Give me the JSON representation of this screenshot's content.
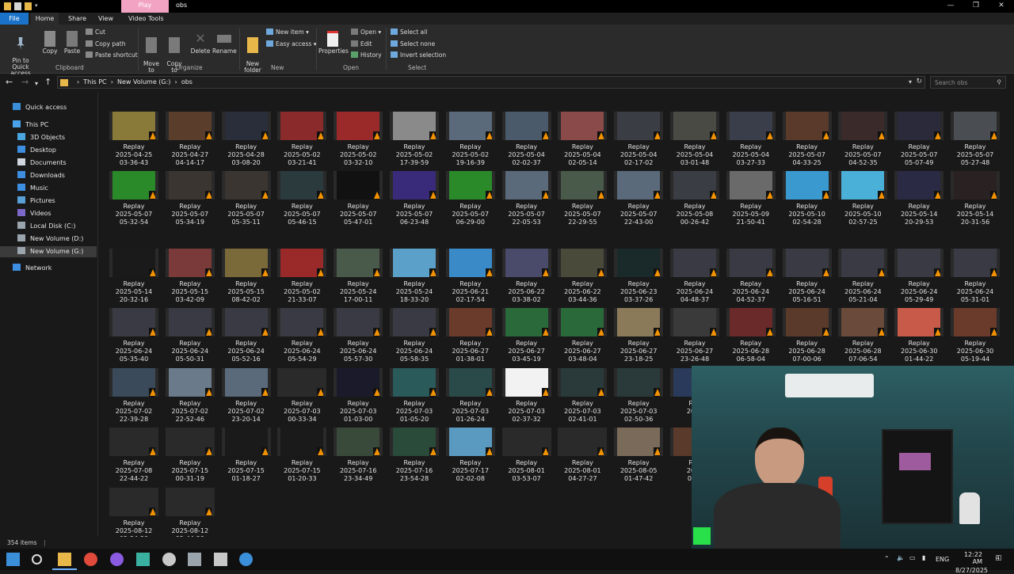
{
  "window": {
    "title": "obs",
    "context_tab": "Play",
    "buttons": {
      "minimize": "—",
      "restore": "❐",
      "close": "✕"
    }
  },
  "ribbon_tabs": [
    "File",
    "Home",
    "Share",
    "View",
    "Video Tools"
  ],
  "ribbon": {
    "clipboard": {
      "pin": "Pin to Quick\naccess",
      "copy": "Copy",
      "paste": "Paste",
      "cut": "Cut",
      "copy_path": "Copy path",
      "paste_shortcut": "Paste shortcut",
      "group": "Clipboard"
    },
    "organize": {
      "move_to": "Move\nto",
      "copy_to": "Copy\nto",
      "delete": "Delete",
      "rename": "Rename",
      "group": "Organize"
    },
    "new": {
      "new_folder": "New\nfolder",
      "new_item": "New item",
      "easy_access": "Easy access",
      "group": "New"
    },
    "open": {
      "properties": "Properties",
      "open": "Open",
      "edit": "Edit",
      "history": "History",
      "group": "Open"
    },
    "select": {
      "select_all": "Select all",
      "select_none": "Select none",
      "invert": "Invert selection",
      "group": "Select"
    }
  },
  "address": {
    "crumbs": [
      "This PC",
      "New Volume (G:)",
      "obs"
    ],
    "search_placeholder": "Search obs"
  },
  "sidebar": [
    {
      "label": "Quick access",
      "icon": "star-icon",
      "color": "#3b8fd9"
    },
    {
      "label": "This PC",
      "icon": "computer-icon",
      "color": "#4aa3e8"
    },
    {
      "label": "3D Objects",
      "icon": "cube-icon",
      "color": "#49a6e0"
    },
    {
      "label": "Desktop",
      "icon": "desktop-icon",
      "color": "#3d8ee0"
    },
    {
      "label": "Documents",
      "icon": "document-icon",
      "color": "#cfd6de"
    },
    {
      "label": "Downloads",
      "icon": "download-icon",
      "color": "#3d8ee0"
    },
    {
      "label": "Music",
      "icon": "music-icon",
      "color": "#3d8ee0"
    },
    {
      "label": "Pictures",
      "icon": "picture-icon",
      "color": "#5aa0d8"
    },
    {
      "label": "Videos",
      "icon": "video-icon",
      "color": "#7b68c8"
    },
    {
      "label": "Local Disk (C:)",
      "icon": "drive-icon",
      "color": "#9aa4ad"
    },
    {
      "label": "New Volume (D:)",
      "icon": "drive-icon",
      "color": "#9aa4ad"
    },
    {
      "label": "New Volume (G:)",
      "icon": "drive-icon",
      "color": "#9aa4ad"
    },
    {
      "label": "Network",
      "icon": "network-icon",
      "color": "#3d8ee0"
    }
  ],
  "files": [
    {
      "name": "Replay",
      "date": "2025-04-25",
      "time": "03-36-43",
      "color": "#8a7a3a"
    },
    {
      "name": "Replay",
      "date": "2025-04-27",
      "time": "04-14-17",
      "color": "#5a3d2a"
    },
    {
      "name": "Replay",
      "date": "2025-04-28",
      "time": "03-08-20",
      "color": "#2a2d3a"
    },
    {
      "name": "Replay",
      "date": "2025-05-02",
      "time": "03-21-41",
      "color": "#8a2a2a"
    },
    {
      "name": "Replay",
      "date": "2025-05-02",
      "time": "03-32-10",
      "color": "#9a2a2a"
    },
    {
      "name": "Replay",
      "date": "2025-05-02",
      "time": "17-39-59",
      "color": "#8a8a8a"
    },
    {
      "name": "Replay",
      "date": "2025-05-02",
      "time": "19-16-39",
      "color": "#5a6a7a"
    },
    {
      "name": "Replay",
      "date": "2025-05-04",
      "time": "02-02-37",
      "color": "#4a5a6a"
    },
    {
      "name": "Replay",
      "date": "2025-05-04",
      "time": "02-05-14",
      "color": "#8a4a4a"
    },
    {
      "name": "Replay",
      "date": "2025-05-04",
      "time": "02-17-02",
      "color": "#3a3d44"
    },
    {
      "name": "Replay",
      "date": "2025-05-04",
      "time": "03-01-48",
      "color": "#4a4a44"
    },
    {
      "name": "Replay",
      "date": "2025-05-04",
      "time": "03-27-33",
      "color": "#3a3d4a"
    },
    {
      "name": "Replay",
      "date": "2025-05-07",
      "time": "04-33-25",
      "color": "#5a3a2a"
    },
    {
      "name": "Replay",
      "date": "2025-05-07",
      "time": "04-52-35",
      "color": "#3a2a2a"
    },
    {
      "name": "Replay",
      "date": "2025-05-07",
      "time": "05-07-49",
      "color": "#2a2a3a"
    },
    {
      "name": "Replay",
      "date": "2025-05-07",
      "time": "05-27-48",
      "color": "#4a4d52"
    },
    {
      "name": "Replay",
      "date": "2025-05-07",
      "time": "05-32-54",
      "color": "#2a8a2a"
    },
    {
      "name": "Replay",
      "date": "2025-05-07",
      "time": "05-34-19",
      "color": "#3a3530"
    },
    {
      "name": "Replay",
      "date": "2025-05-07",
      "time": "05-35-11",
      "color": "#3a3530"
    },
    {
      "name": "Replay",
      "date": "2025-05-07",
      "time": "05-46-15",
      "color": "#2a3a3d"
    },
    {
      "name": "Replay",
      "date": "2025-05-07",
      "time": "05-47-01",
      "color": "#111111"
    },
    {
      "name": "Replay",
      "date": "2025-05-07",
      "time": "06-23-48",
      "color": "#3a2a7a"
    },
    {
      "name": "Replay",
      "date": "2025-05-07",
      "time": "06-29-00",
      "color": "#2a8a2a"
    },
    {
      "name": "Replay",
      "date": "2025-05-07",
      "time": "22-05-53",
      "color": "#5a6a7a"
    },
    {
      "name": "Replay",
      "date": "2025-05-07",
      "time": "22-29-55",
      "color": "#4a5a4a"
    },
    {
      "name": "Replay",
      "date": "2025-05-07",
      "time": "22-43-00",
      "color": "#5a6a7a"
    },
    {
      "name": "Replay",
      "date": "2025-05-08",
      "time": "00-26-42",
      "color": "#3a3d44"
    },
    {
      "name": "Replay",
      "date": "2025-05-09",
      "time": "21-50-41",
      "color": "#6a6a6a"
    },
    {
      "name": "Replay",
      "date": "2025-05-10",
      "time": "02-54-28",
      "color": "#3a9ad0"
    },
    {
      "name": "Replay",
      "date": "2025-05-10",
      "time": "02-57-25",
      "color": "#4ab0d8"
    },
    {
      "name": "Replay",
      "date": "2025-05-14",
      "time": "20-29-53",
      "color": "#2a2a44"
    },
    {
      "name": "Replay",
      "date": "2025-05-14",
      "time": "20-31-56",
      "color": "#2a2222"
    },
    {
      "name": "Replay",
      "date": "2025-05-14",
      "time": "20-32-16",
      "color": "#1a1a1a"
    },
    {
      "name": "Replay",
      "date": "2025-05-15",
      "time": "03-42-09",
      "color": "#7a3a3a"
    },
    {
      "name": "Replay",
      "date": "2025-05-15",
      "time": "08-42-02",
      "color": "#7a6a3a"
    },
    {
      "name": "Replay",
      "date": "2025-05-02",
      "time": "21-33-07",
      "color": "#9a2a2a"
    },
    {
      "name": "Replay",
      "date": "2025-05-24",
      "time": "17-00-11",
      "color": "#4a5a4a"
    },
    {
      "name": "Replay",
      "date": "2025-05-24",
      "time": "18-33-20",
      "color": "#5aa0c8"
    },
    {
      "name": "Replay",
      "date": "2025-06-21",
      "time": "02-17-54",
      "color": "#3a8ac8"
    },
    {
      "name": "Replay",
      "date": "2025-06-22",
      "time": "03-38-02",
      "color": "#4a4a6a"
    },
    {
      "name": "Replay",
      "date": "2025-06-22",
      "time": "03-44-36",
      "color": "#4a4a3a"
    },
    {
      "name": "Replay",
      "date": "2025-06-23",
      "time": "03-37-26",
      "color": "#1a2a2a"
    },
    {
      "name": "Replay",
      "date": "2025-06-24",
      "time": "04-48-37",
      "color": "#3a3a44"
    },
    {
      "name": "Replay",
      "date": "2025-06-24",
      "time": "04-52-37",
      "color": "#3a3a44"
    },
    {
      "name": "Replay",
      "date": "2025-06-24",
      "time": "05-16-51",
      "color": "#3a3a44"
    },
    {
      "name": "Replay",
      "date": "2025-06-24",
      "time": "05-21-04",
      "color": "#3a3a44"
    },
    {
      "name": "Replay",
      "date": "2025-06-24",
      "time": "05-29-49",
      "color": "#3a3a44"
    },
    {
      "name": "Replay",
      "date": "2025-06-24",
      "time": "05-31-01",
      "color": "#3a3a44"
    },
    {
      "name": "Replay",
      "date": "2025-06-24",
      "time": "05-35-40",
      "color": "#3a3a44"
    },
    {
      "name": "Replay",
      "date": "2025-06-24",
      "time": "05-50-31",
      "color": "#3a3a44"
    },
    {
      "name": "Replay",
      "date": "2025-06-24",
      "time": "05-52-16",
      "color": "#3a3a44"
    },
    {
      "name": "Replay",
      "date": "2025-06-24",
      "time": "05-54-29",
      "color": "#3a3a44"
    },
    {
      "name": "Replay",
      "date": "2025-06-24",
      "time": "05-57-30",
      "color": "#3a3a44"
    },
    {
      "name": "Replay",
      "date": "2025-06-24",
      "time": "05-58-35",
      "color": "#3a3a44"
    },
    {
      "name": "Replay",
      "date": "2025-06-27",
      "time": "01-38-01",
      "color": "#6a3a2a"
    },
    {
      "name": "Replay",
      "date": "2025-06-27",
      "time": "03-45-19",
      "color": "#2a6a3a"
    },
    {
      "name": "Replay",
      "date": "2025-06-27",
      "time": "03-48-04",
      "color": "#2a6a3a"
    },
    {
      "name": "Replay",
      "date": "2025-06-27",
      "time": "23-18-25",
      "color": "#8a7a5a"
    },
    {
      "name": "Replay",
      "date": "2025-06-27",
      "time": "23-26-48",
      "color": "#3a3a3a"
    },
    {
      "name": "Replay",
      "date": "2025-06-28",
      "time": "06-58-04",
      "color": "#6a2a2a"
    },
    {
      "name": "Replay",
      "date": "2025-06-28",
      "time": "07-00-06",
      "color": "#5a3a2a"
    },
    {
      "name": "Replay",
      "date": "2025-06-28",
      "time": "07-06-54",
      "color": "#6a4a3a"
    },
    {
      "name": "Replay",
      "date": "2025-06-30",
      "time": "01-44-22",
      "color": "#c85a4a"
    },
    {
      "name": "Replay",
      "date": "2025-06-30",
      "time": "05-19-44",
      "color": "#6a3a2a"
    },
    {
      "name": "Replay",
      "date": "2025-07-02",
      "time": "22-39-28",
      "color": "#3a4a5a"
    },
    {
      "name": "Replay",
      "date": "2025-07-02",
      "time": "22-52-46",
      "color": "#6a7a8a"
    },
    {
      "name": "Replay",
      "date": "2025-07-02",
      "time": "23-20-14",
      "color": "#5a6a7a"
    },
    {
      "name": "Replay",
      "date": "2025-07-03",
      "time": "00-33-34",
      "color": "#2a2a2a"
    },
    {
      "name": "Replay",
      "date": "2025-07-03",
      "time": "01-03-00",
      "color": "#1a1a2a"
    },
    {
      "name": "Replay",
      "date": "2025-07-03",
      "time": "01-05-20",
      "color": "#2a5a5a"
    },
    {
      "name": "Replay",
      "date": "2025-07-03",
      "time": "01-26-24",
      "color": "#2a4a4a"
    },
    {
      "name": "Replay",
      "date": "2025-07-03",
      "time": "02-37-32",
      "color": "#f2f2f2"
    },
    {
      "name": "Replay",
      "date": "2025-07-03",
      "time": "02-41-01",
      "color": "#2a3a3a"
    },
    {
      "name": "Replay",
      "date": "2025-07-03",
      "time": "02-50-36",
      "color": "#2a3a3a"
    },
    {
      "name": "Rep",
      "date": "2025",
      "time": "",
      "color": "#2a3a5a"
    },
    {
      "name": "Replay",
      "date": "2025-07-08",
      "time": "22-44-22",
      "color": "#2a2a2a"
    },
    {
      "name": "Replay",
      "date": "2025-07-15",
      "time": "00-31-19",
      "color": "#2a2a2a"
    },
    {
      "name": "Replay",
      "date": "2025-07-15",
      "time": "01-18-27",
      "color": "#1a1a1a"
    },
    {
      "name": "Replay",
      "date": "2025-07-15",
      "time": "01-20-33",
      "color": "#1a1a1a"
    },
    {
      "name": "Replay",
      "date": "2025-07-16",
      "time": "23-34-49",
      "color": "#3a4a3a"
    },
    {
      "name": "Replay",
      "date": "2025-07-16",
      "time": "23-54-28",
      "color": "#2a4a3a"
    },
    {
      "name": "Replay",
      "date": "2025-07-17",
      "time": "02-02-08",
      "color": "#5a9ac0"
    },
    {
      "name": "Replay",
      "date": "2025-08-01",
      "time": "03-53-07",
      "color": "#2a2a2a"
    },
    {
      "name": "Replay",
      "date": "2025-08-01",
      "time": "04-27-27",
      "color": "#2a2a2a"
    },
    {
      "name": "Replay",
      "date": "2025-08-05",
      "time": "01-47-42",
      "color": "#7a6a5a"
    },
    {
      "name": "Rep",
      "date": "2025",
      "time": "01-5",
      "color": "#5a3a2a"
    },
    {
      "name": "Replay",
      "date": "2025-08-12",
      "time": "05-34-59",
      "color": "#2a2a2a"
    },
    {
      "name": "Replay",
      "date": "2025-08-12",
      "time": "05-44-29",
      "color": "#2a2a2a"
    }
  ],
  "status": {
    "items": "354 items"
  },
  "taskbar": {
    "icons": [
      "windows-icon",
      "search-icon",
      "file-explorer-icon",
      "chrome-icon",
      "messenger-icon",
      "download-app-icon",
      "steam-icon",
      "game-icon",
      "notepad-icon",
      "steam-alt-icon"
    ],
    "tray": {
      "lang": "ENG",
      "time": "12:22 AM",
      "date": "8/27/2025",
      "notif": "4"
    }
  }
}
